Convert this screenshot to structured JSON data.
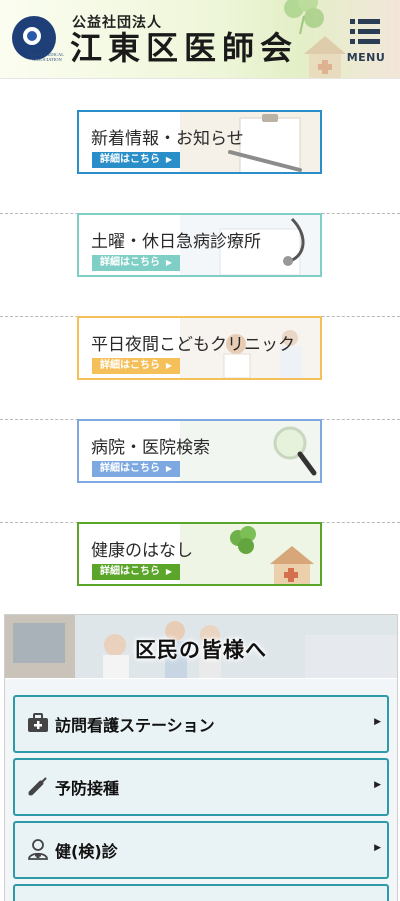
{
  "header": {
    "subtitle": "公益社団法人",
    "title": "江東区医師会",
    "logo_text": "KOTO MEDICAL ASSOCIATION",
    "menu_label": "MENU",
    "menu_icon": "hamburger-icon"
  },
  "banners": [
    {
      "label": "新着情報・お知らせ",
      "more": "詳細はこちら",
      "color": "#2a8fc9",
      "icon": "clipboard-pen-image"
    },
    {
      "label": "土曜・休日急病診療所",
      "more": "詳細はこちら",
      "color": "#7fcfc6",
      "icon": "stethoscope-image"
    },
    {
      "label": "平日夜間こどもクリニック",
      "more": "詳細はこちら",
      "color": "#f5c05a",
      "icon": "doctor-child-image"
    },
    {
      "label": "病院・医院検索",
      "more": "詳細はこちら",
      "color": "#7da8e0",
      "icon": "magnifier-image"
    },
    {
      "label": "健康のはなし",
      "more": "詳細はこちら",
      "color": "#5aa52a",
      "icon": "clover-house-image"
    }
  ],
  "residents": {
    "title": "区民の皆様へ",
    "items": [
      {
        "label": "訪問看護ステーション",
        "icon": "medical-bag-icon"
      },
      {
        "label": "予防接種",
        "icon": "syringe-icon"
      },
      {
        "label": "健(検)診",
        "icon": "doctor-icon"
      },
      {
        "label": "",
        "icon": ""
      }
    ]
  },
  "colors": {
    "accent": "#2e9aa8",
    "item_bg": "#e9f2f5"
  }
}
